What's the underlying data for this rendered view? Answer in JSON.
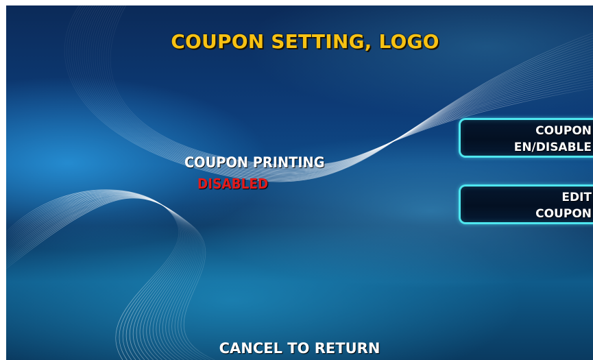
{
  "screen": {
    "title": "COUPON SETTING, LOGO"
  },
  "status": {
    "label": "COUPON PRINTING",
    "value": "DISABLED",
    "value_color": "#e21b1b"
  },
  "buttons": {
    "enable_disable": {
      "line1": "COUPON",
      "line2": "EN/DISABLE"
    },
    "edit": {
      "line1": "EDIT",
      "line2": "COUPON"
    }
  },
  "footer": {
    "cancel_label": "CANCEL TO RETURN"
  },
  "colors": {
    "title": "#f7c213",
    "button_border": "#4fe7ef",
    "button_bg": "#031022",
    "text": "#ffffff"
  }
}
